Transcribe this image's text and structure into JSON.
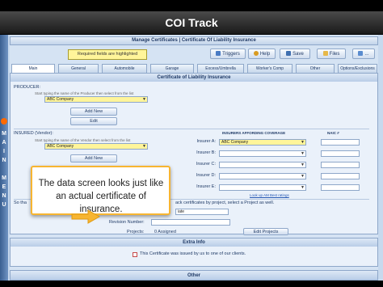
{
  "window": {
    "title": "COI Track"
  },
  "side_menu": {
    "label": "MAIN MENU"
  },
  "header": {
    "title": "Manage Certificates | Certificate Of Liability Insurance"
  },
  "notice": {
    "required_fields": "Required fields are highlighted"
  },
  "toolbar": {
    "triggers": "Triggers",
    "help": "Help",
    "save": "Save",
    "files": "Files",
    "extra": "..."
  },
  "tabs": [
    "Main",
    "General",
    "Automobile",
    "Garage",
    "Excess/Umbrella",
    "Worker's Comp",
    "Other",
    "Options/Exclusions"
  ],
  "certificate": {
    "heading": "Certificate of Liability Insurance",
    "producer_label": "PRODUCER:",
    "producer_hint": "Start typing the name of the Producer then select from the list",
    "producer_value": "ABC Company",
    "add_new": "Add New",
    "edit": "Edit",
    "insured_label": "INSURED (Vendor):",
    "insured_hint": "Start typing the name of the Vendor then select from the list",
    "insured_value": "ABC Company",
    "insured_add_new": "Add New",
    "insurers_heading": "INSURERS AFFORDING COVERAGE",
    "naic_heading": "NAIC #",
    "insurers": [
      {
        "label": "Insurer A:",
        "value": "ABC Company",
        "highlight": true
      },
      {
        "label": "Insurer B:",
        "value": "",
        "highlight": false
      },
      {
        "label": "Insurer C:",
        "value": "",
        "highlight": false
      },
      {
        "label": "Insurer D:",
        "value": "",
        "highlight": false
      },
      {
        "label": "Insurer E:",
        "value": "",
        "highlight": false
      }
    ],
    "lookup_link": "Look up AM Best ratings",
    "so_prefix": "So tha",
    "projects_note": "ack certificates by project, select a Project as well.",
    "date_value": "iate",
    "revision_label": "Revision Number:",
    "projects_label": "Projects:",
    "projects_value": "0 Assigned",
    "edit_projects": "Edit Projects"
  },
  "extra_info": {
    "heading": "Extra Info",
    "checkbox_label": "This Certificate was issued by us to one of our clients."
  },
  "other": {
    "heading": "Other"
  },
  "callout": {
    "text": "The data screen looks just like an actual certificate of insurance."
  },
  "colors": {
    "accent": "#f7b531",
    "highlight": "#fff59a",
    "brand": "#1f3a66"
  }
}
